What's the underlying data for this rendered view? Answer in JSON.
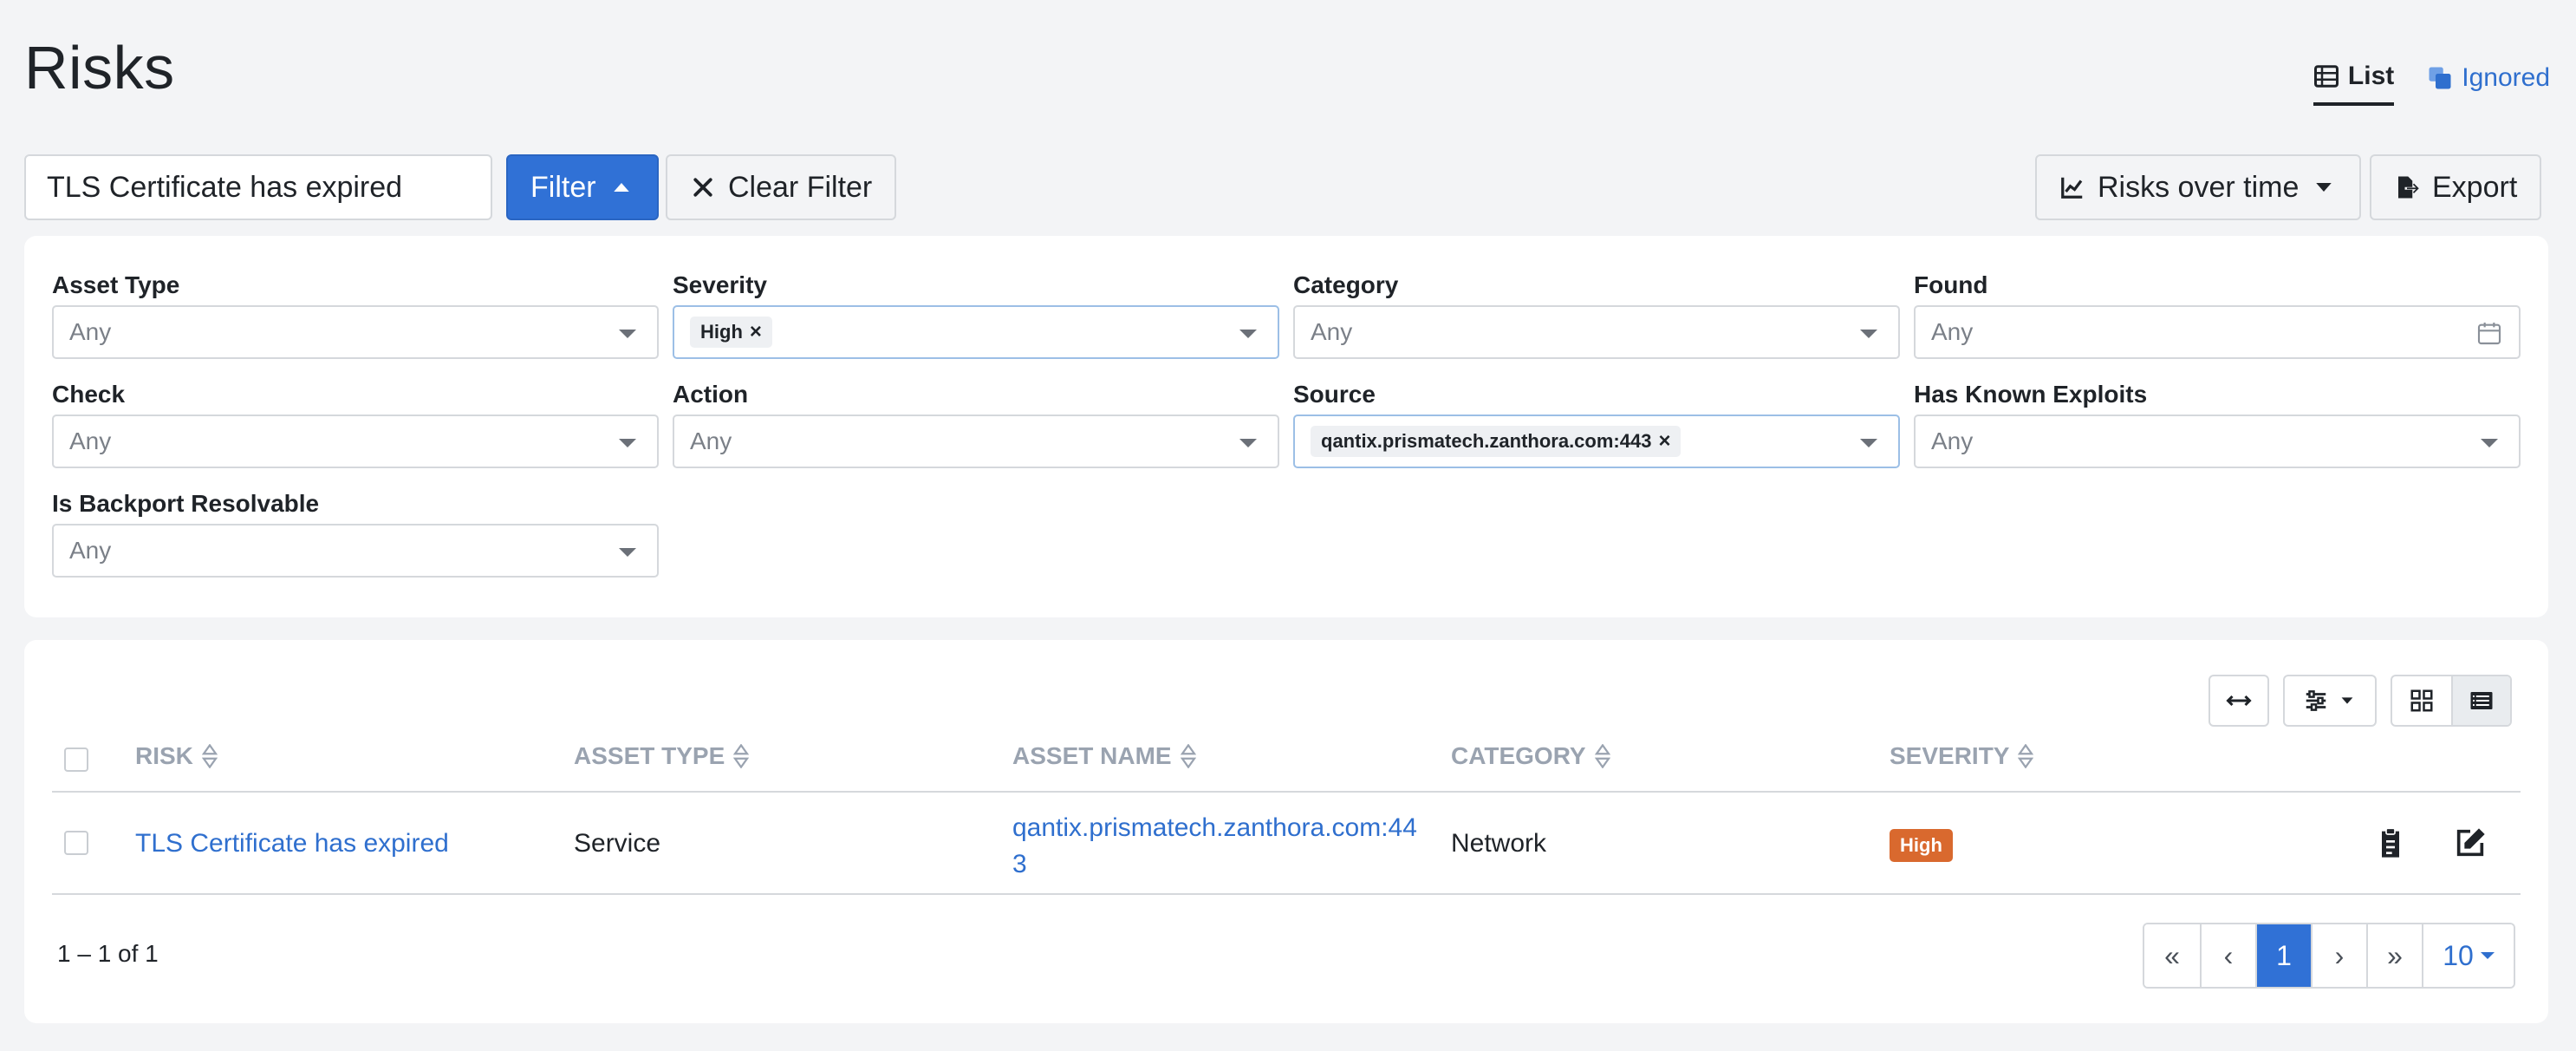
{
  "header": {
    "title": "Risks",
    "tabs": [
      {
        "label": "List",
        "icon": "list-icon",
        "active": true
      },
      {
        "label": "Ignored",
        "icon": "ignored-icon",
        "active": false
      }
    ]
  },
  "toolbar": {
    "search_value": "TLS Certificate has expired",
    "filter_label": "Filter",
    "clear_filter_label": "Clear Filter",
    "risks_over_time_label": "Risks over time",
    "export_label": "Export"
  },
  "filters": {
    "asset_type": {
      "label": "Asset Type",
      "value": "Any"
    },
    "severity": {
      "label": "Severity",
      "chip": "High"
    },
    "category": {
      "label": "Category",
      "value": "Any"
    },
    "found": {
      "label": "Found",
      "value": "Any"
    },
    "check": {
      "label": "Check",
      "value": "Any"
    },
    "action": {
      "label": "Action",
      "value": "Any"
    },
    "source": {
      "label": "Source",
      "chip": "qantix.prismatech.zanthora.com:443"
    },
    "has_known_exploits": {
      "label": "Has Known Exploits",
      "value": "Any"
    },
    "is_backport_resolvable": {
      "label": "Is Backport Resolvable",
      "value": "Any"
    }
  },
  "table": {
    "columns": [
      "RISK",
      "ASSET TYPE",
      "ASSET NAME",
      "CATEGORY",
      "SEVERITY"
    ],
    "rows": [
      {
        "risk": "TLS Certificate has expired",
        "asset_type": "Service",
        "asset_name_line1": "qantix.prismatech.zanthora.com:44",
        "asset_name_line2": "3",
        "category": "Network",
        "severity": "High"
      }
    ]
  },
  "pagination": {
    "range_text": "1 – 1 of 1",
    "first": "«",
    "prev": "‹",
    "current": "1",
    "next": "›",
    "last": "»",
    "page_size": "10"
  },
  "colors": {
    "primary": "#3071d6",
    "link": "#2f6fce",
    "severity_high": "#d9692e"
  }
}
